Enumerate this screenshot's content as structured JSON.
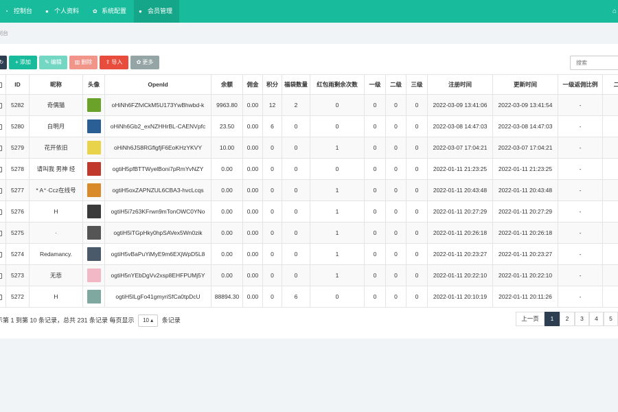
{
  "nav": {
    "tabs": [
      {
        "icon": "dashboard-icon",
        "glyph": "◔",
        "label": "控制台"
      },
      {
        "icon": "user-icon",
        "glyph": "●",
        "label": "个人资料"
      },
      {
        "icon": "gear-icon",
        "glyph": "✿",
        "label": "系统配置"
      },
      {
        "icon": "user-icon",
        "glyph": "●",
        "label": "会员管理"
      }
    ],
    "home_glyph": "⌂"
  },
  "breadcrumb": "制台",
  "toolbar": {
    "refresh_glyph": "↻",
    "add": "添加",
    "add_glyph": "+",
    "edit": "编辑",
    "edit_glyph": "✎",
    "delete": "删除",
    "delete_glyph": "▥",
    "import": "导入",
    "import_glyph": "⇪",
    "more": "更多",
    "more_glyph": "✿"
  },
  "search": {
    "placeholder": "搜索"
  },
  "table": {
    "headers": [
      "ID",
      "昵称",
      "头像",
      "OpenId",
      "余额",
      "佣金",
      "积分",
      "福袋数量",
      "红包雨剩余次数",
      "一级",
      "二级",
      "三级",
      "注册时间",
      "更新时间",
      "一级返佣比例",
      "二"
    ],
    "rows": [
      {
        "id": "5282",
        "nickname": "奇偶猫",
        "openid": "oHiNh6FZfvlCkM5U173YwBhwbd-k",
        "balance": "9963.80",
        "commission": "0.00",
        "points": "12",
        "bags": "2",
        "rain": "0",
        "l1": "0",
        "l2": "0",
        "l3": "0",
        "reg": "2022-03-09 13:41:06",
        "upd": "2022-03-09 13:41:54",
        "ratio": "-",
        "av": "#6aa22a"
      },
      {
        "id": "5280",
        "nickname": "白明月",
        "openid": "oHiNh6Gb2_exNZHHrBL-CAENVpfc",
        "balance": "23.50",
        "commission": "0.00",
        "points": "6",
        "bags": "0",
        "rain": "0",
        "l1": "0",
        "l2": "0",
        "l3": "0",
        "reg": "2022-03-08 14:47:03",
        "upd": "2022-03-08 14:47:03",
        "ratio": "-",
        "av": "#2a5f95"
      },
      {
        "id": "5279",
        "nickname": "花开依旧",
        "openid": "oHiNh6JS8RGflgfjF6EoKHzYKVY",
        "balance": "10.00",
        "commission": "0.00",
        "points": "0",
        "bags": "0",
        "rain": "1",
        "l1": "0",
        "l2": "0",
        "l3": "0",
        "reg": "2022-03-07 17:04:21",
        "upd": "2022-03-07 17:04:21",
        "ratio": "-",
        "av": "#e8d34a"
      },
      {
        "id": "5278",
        "nickname": "请叫我 男神 经",
        "openid": "ogtiH5pfBTTWyelBoni7pRmYvNZY",
        "balance": "0.00",
        "commission": "0.00",
        "points": "0",
        "bags": "0",
        "rain": "0",
        "l1": "0",
        "l2": "0",
        "l3": "0",
        "reg": "2022-01-11 21:23:25",
        "upd": "2022-01-11 21:23:25",
        "ratio": "-",
        "av": "#c0392b"
      },
      {
        "id": "5277",
        "nickname": "* A⁺·Ccz在线号",
        "openid": "ogtiH5oxZAPNZUL6CBA3-hvcLcqs",
        "balance": "0.00",
        "commission": "0.00",
        "points": "0",
        "bags": "0",
        "rain": "1",
        "l1": "0",
        "l2": "0",
        "l3": "0",
        "reg": "2022-01-11 20:43:48",
        "upd": "2022-01-11 20:43:48",
        "ratio": "-",
        "av": "#d98a2b"
      },
      {
        "id": "5276",
        "nickname": "H",
        "openid": "ogtiH5i7z63KFrwn9mTonOWC0YNo",
        "balance": "0.00",
        "commission": "0.00",
        "points": "0",
        "bags": "0",
        "rain": "1",
        "l1": "0",
        "l2": "0",
        "l3": "0",
        "reg": "2022-01-11 20:27:29",
        "upd": "2022-01-11 20:27:29",
        "ratio": "-",
        "av": "#3a3a3a"
      },
      {
        "id": "5275",
        "nickname": "·",
        "openid": "ogtiH5iTGpHky0hpSAVex5Wn0zik",
        "balance": "0.00",
        "commission": "0.00",
        "points": "0",
        "bags": "0",
        "rain": "1",
        "l1": "0",
        "l2": "0",
        "l3": "0",
        "reg": "2022-01-11 20:26:18",
        "upd": "2022-01-11 20:26:18",
        "ratio": "-",
        "av": "#555555"
      },
      {
        "id": "5274",
        "nickname": "Redamancy.",
        "openid": "ogtiH5vBaPuYiMyE9m6EXjWpD5L8",
        "balance": "0.00",
        "commission": "0.00",
        "points": "0",
        "bags": "0",
        "rain": "1",
        "l1": "0",
        "l2": "0",
        "l3": "0",
        "reg": "2022-01-11 20:23:27",
        "upd": "2022-01-11 20:23:27",
        "ratio": "-",
        "av": "#4a5a6a"
      },
      {
        "id": "5273",
        "nickname": "无悲",
        "openid": "ogtiH5nYEbDgVv2xsp8EHFPUMj5Y",
        "balance": "0.00",
        "commission": "0.00",
        "points": "0",
        "bags": "0",
        "rain": "1",
        "l1": "0",
        "l2": "0",
        "l3": "0",
        "reg": "2022-01-11 20:22:10",
        "upd": "2022-01-11 20:22:10",
        "ratio": "-",
        "av": "#f2b8c6"
      },
      {
        "id": "5272",
        "nickname": "H",
        "openid": "ogtiH5lLgFo41gmyriSfCa0tpDcU",
        "balance": "88894.30",
        "commission": "0.00",
        "points": "0",
        "bags": "6",
        "rain": "0",
        "l1": "0",
        "l2": "0",
        "l3": "0",
        "reg": "2022-01-11 20:10:19",
        "upd": "2022-01-11 20:11:26",
        "ratio": "-",
        "av": "#7fa8a0"
      }
    ]
  },
  "pagination": {
    "info_prefix": "示第 1 到第 10 条记录，总共 231 条记录 每页显示",
    "page_size": "10 ▴",
    "info_suffix": "条记录",
    "prev": "上一页",
    "pages": [
      "1",
      "2",
      "3",
      "4",
      "5"
    ]
  }
}
